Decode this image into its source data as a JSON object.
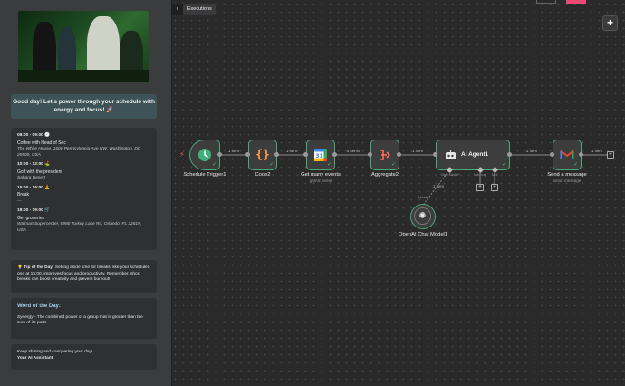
{
  "tabs": [
    {
      "label": "r",
      "active": false
    },
    {
      "label": "Executions",
      "active": true
    }
  ],
  "canvas": {
    "zoom_label": "+"
  },
  "email": {
    "greeting": "Good day! Let's power through your schedule with energy and focus! 🚀",
    "events": [
      {
        "time": "08:00 - 09:00 🕗",
        "title": "Coffee with Head of Sec",
        "location": "The White House, 1600 Pennsylvania Ave NW, Washington, DC 20500, USA"
      },
      {
        "time": "10:00 - 12:00 ⛳",
        "title": "Golf with the president",
        "location": "Sahara Desert"
      },
      {
        "time": "15:00 - 16:00 🧘",
        "title": "Break",
        "location": "—"
      },
      {
        "time": "18:00 - 19:00 🛒",
        "title": "Get groceries",
        "location": "Walmart Supercenter, 8990 Turkey Lake Rd, Orlando, FL 32819, USA"
      }
    ],
    "tip_label": "💡 Tip of the Day:",
    "tip_text": "Setting aside time for breaks, like your scheduled one at 15:00, improves focus and productivity. Remember, short breaks can boost creativity and prevent burnout!",
    "word_heading": "Word of the Day:",
    "word_term": "Synergy",
    "word_definition": " - The combined power of a group that is greater than the sum of its parts.",
    "closing_line": "Keep shining and conquering your day!",
    "signature": "Your AI Assistant"
  },
  "nodes": {
    "schedule_trigger": {
      "label": "Schedule Trigger1"
    },
    "code": {
      "label": "Code2"
    },
    "calendar": {
      "label": "Get many events",
      "sublabel": "getAll: event"
    },
    "aggregate": {
      "label": "Aggregate2"
    },
    "agent": {
      "label": "AI Agent1",
      "sub_chat": "Chat Model*",
      "sub_memory": "Memory",
      "sub_tool": "Tool"
    },
    "gmail": {
      "label": "Send a message",
      "sublabel": "send: message"
    },
    "openai": {
      "label": "OpenAI Chat Model1",
      "port_label": "Model"
    }
  },
  "connections": {
    "c1": "1 item",
    "c2": "1 item",
    "c3": "4 items",
    "c4": "1 item",
    "c5": "1 item",
    "c6": "1 item",
    "model": "1 item"
  },
  "colors": {
    "node_border": "#4aa87a",
    "greeting_bg": "#3d5357",
    "word_heading": "#9fd3f0",
    "trigger_icon": "#3fb07a",
    "code_icon": "#ff9f45",
    "aggregate_icon": "#ff6a5c",
    "gmail_red": "#ea4335"
  },
  "icons": {
    "trigger": "clock-icon",
    "code": "braces-icon",
    "calendar": "google-calendar-icon",
    "aggregate": "aggregate-icon",
    "agent": "robot-icon",
    "gmail": "gmail-icon",
    "openai": "openai-icon",
    "bolt": "lightning-icon"
  }
}
